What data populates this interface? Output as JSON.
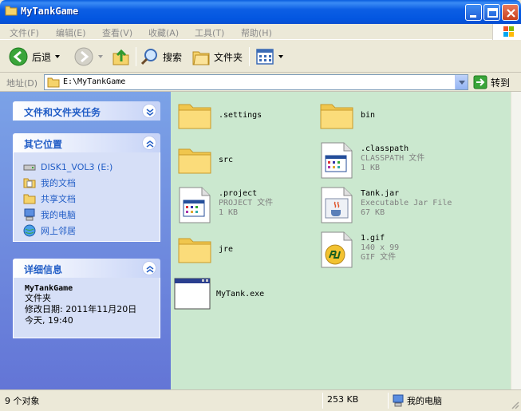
{
  "window": {
    "title": "MyTankGame"
  },
  "menu": [
    "文件(F)",
    "编辑(E)",
    "查看(V)",
    "收藏(A)",
    "工具(T)",
    "帮助(H)"
  ],
  "toolbar": {
    "back_label": "后退",
    "search_label": "搜索",
    "folders_label": "文件夹"
  },
  "address": {
    "label": "地址(D)",
    "path": "E:\\MyTankGame",
    "go_label": "转到"
  },
  "taskpane": {
    "tasks_title": "文件和文件夹任务",
    "places_title": "其它位置",
    "places": [
      "DISK1_VOL3 (E:)",
      "我的文档",
      "共享文档",
      "我的电脑",
      "网上邻居"
    ],
    "details_title": "详细信息",
    "details": {
      "name": "MyTankGame",
      "type": "文件夹",
      "modified": "修改日期: 2011年11月20日",
      "time": "今天, 19:40"
    }
  },
  "files": [
    {
      "name": ".settings",
      "type": "",
      "size": "",
      "icon": "folder-icon"
    },
    {
      "name": "bin",
      "type": "",
      "size": "",
      "icon": "folder-icon"
    },
    {
      "name": "src",
      "type": "",
      "size": "",
      "icon": "folder-icon"
    },
    {
      "name": ".classpath",
      "type": "CLASSPATH 文件",
      "size": "1 KB",
      "icon": "document-icon"
    },
    {
      "name": ".project",
      "type": "PROJECT 文件",
      "size": "1 KB",
      "icon": "document-icon"
    },
    {
      "name": "Tank.jar",
      "type": "Executable Jar File",
      "size": "67 KB",
      "icon": "java-jar-icon"
    },
    {
      "name": "jre",
      "type": "",
      "size": "",
      "icon": "folder-icon"
    },
    {
      "name": "1.gif",
      "type": "140 x 99",
      "size": "GIF 文件",
      "icon": "gif-image-icon"
    },
    {
      "name": "MyTank.exe",
      "type": "",
      "size": "",
      "icon": "exe-window-icon"
    }
  ],
  "status": {
    "count": "9 个对象",
    "size": "253 KB",
    "location": "我的电脑"
  },
  "colors": {
    "titlebar": "#0356e0",
    "content_bg": "#cbe8cf",
    "taskpane_bg": "#6f8fdf",
    "link": "#215dc6"
  }
}
